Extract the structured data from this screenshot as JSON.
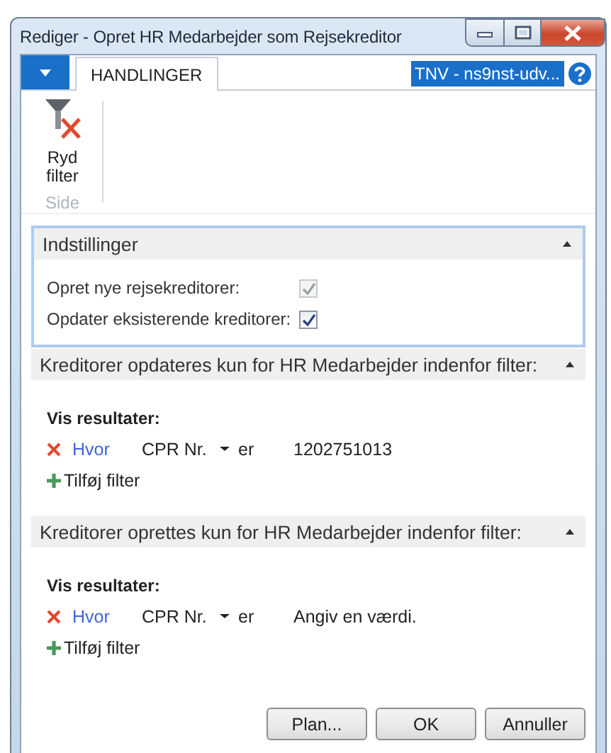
{
  "window": {
    "title": "Rediger - Opret HR Medarbejder som Rejsekreditor"
  },
  "ribbon": {
    "tabs": [
      {
        "label": "HANDLINGER",
        "selected": true
      }
    ],
    "company": "TNV - ns9nst-udv...",
    "actions": [
      {
        "label": "Ryd filter"
      }
    ],
    "group": "Side"
  },
  "settings": {
    "title": "Indstillinger",
    "expanded": true,
    "fields": [
      {
        "label": "Opret nye rejsekreditorer:",
        "checked": true,
        "disabled": true
      },
      {
        "label": "Opdater eksisterende kreditorer:",
        "checked": true,
        "disabled": false
      }
    ]
  },
  "filter_sections": [
    {
      "title": "Kreditorer opdateres kun for HR Medarbejder indenfor filter:",
      "expanded": true,
      "show_label": "Vis resultater:",
      "filters": [
        {
          "link": "Hvor",
          "field": "CPR Nr.",
          "operator": "er",
          "value": "1202751013"
        }
      ],
      "add_filter": "Tilføj filter"
    },
    {
      "title": "Kreditorer oprettes kun for HR Medarbejder indenfor filter:",
      "expanded": true,
      "show_label": "Vis resultater:",
      "filters": [
        {
          "link": "Hvor",
          "field": "CPR Nr.",
          "operator": "er",
          "placeholder": "Angiv en værdi."
        }
      ],
      "add_filter": "Tilføj filter"
    }
  ],
  "buttons": [
    "Plan...",
    "OK",
    "Annuller"
  ]
}
